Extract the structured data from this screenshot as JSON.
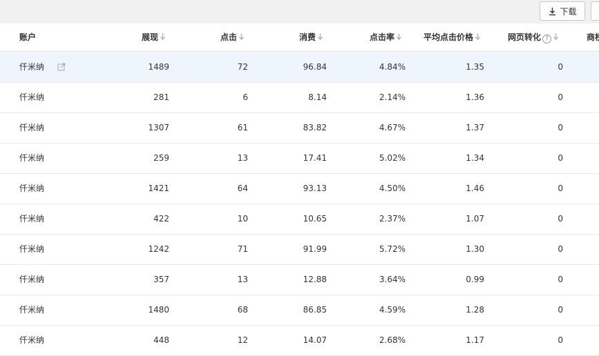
{
  "toolbar": {
    "download_label": "下载"
  },
  "columns": [
    "账户",
    "展现",
    "点击",
    "消费",
    "点击率",
    "平均点击价格",
    "网页转化",
    "商桥"
  ],
  "rows": [
    {
      "account": "仟米纳",
      "impressions": "1489",
      "clicks": "72",
      "cost": "96.84",
      "ctr": "4.84%",
      "cpc": "1.35",
      "conversions": "0"
    },
    {
      "account": "仟米纳",
      "impressions": "281",
      "clicks": "6",
      "cost": "8.14",
      "ctr": "2.14%",
      "cpc": "1.36",
      "conversions": "0"
    },
    {
      "account": "仟米纳",
      "impressions": "1307",
      "clicks": "61",
      "cost": "83.82",
      "ctr": "4.67%",
      "cpc": "1.37",
      "conversions": "0"
    },
    {
      "account": "仟米纳",
      "impressions": "259",
      "clicks": "13",
      "cost": "17.41",
      "ctr": "5.02%",
      "cpc": "1.34",
      "conversions": "0"
    },
    {
      "account": "仟米纳",
      "impressions": "1421",
      "clicks": "64",
      "cost": "93.13",
      "ctr": "4.50%",
      "cpc": "1.46",
      "conversions": "0"
    },
    {
      "account": "仟米纳",
      "impressions": "422",
      "clicks": "10",
      "cost": "10.65",
      "ctr": "2.37%",
      "cpc": "1.07",
      "conversions": "0"
    },
    {
      "account": "仟米纳",
      "impressions": "1242",
      "clicks": "71",
      "cost": "91.99",
      "ctr": "5.72%",
      "cpc": "1.30",
      "conversions": "0"
    },
    {
      "account": "仟米纳",
      "impressions": "357",
      "clicks": "13",
      "cost": "12.88",
      "ctr": "3.64%",
      "cpc": "0.99",
      "conversions": "0"
    },
    {
      "account": "仟米纳",
      "impressions": "1480",
      "clicks": "68",
      "cost": "86.85",
      "ctr": "4.59%",
      "cpc": "1.28",
      "conversions": "0"
    },
    {
      "account": "仟米纳",
      "impressions": "448",
      "clicks": "12",
      "cost": "14.07",
      "ctr": "2.68%",
      "cpc": "1.17",
      "conversions": "0"
    }
  ],
  "icons": {
    "download": "download-icon",
    "sort": "sort-down-arrow-icon",
    "help": "question-circle-icon",
    "edit": "external-edit-icon"
  },
  "colors": {
    "header_bg": "#f1f1f1",
    "highlight_row": "#eef5fd",
    "text": "#333333",
    "border": "#e8e8e8"
  }
}
